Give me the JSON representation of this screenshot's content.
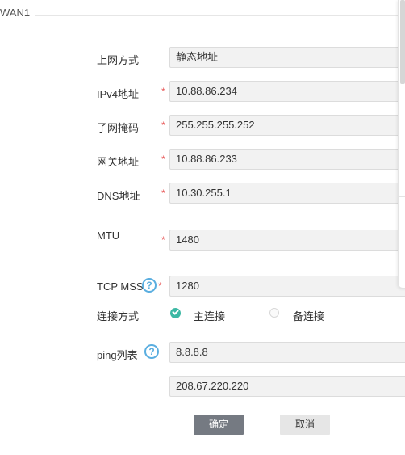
{
  "section": {
    "title": "WAN1"
  },
  "form": {
    "mode": {
      "label": "上网方式",
      "value": "静态地址"
    },
    "ipv4": {
      "label": "IPv4地址",
      "value": "10.88.86.234"
    },
    "mask": {
      "label": "子网掩码",
      "value": "255.255.255.252"
    },
    "gateway": {
      "label": "网关地址",
      "value": "10.88.86.233"
    },
    "dns": {
      "label": "DNS地址",
      "value": "10.30.255.1"
    },
    "mtu": {
      "label": "MTU",
      "value": "1480"
    },
    "tcp_mss": {
      "label": "TCP MSS",
      "value": "1280"
    },
    "connection": {
      "label": "连接方式",
      "options": [
        "主连接",
        "备连接"
      ],
      "selected": "主连接"
    },
    "ping_list": {
      "label": "ping列表",
      "values": [
        "8.8.8.8",
        "208.67.220.220"
      ]
    },
    "required_mark": "*",
    "help_glyph": "?"
  },
  "buttons": {
    "confirm": "确定",
    "cancel": "取消"
  },
  "colors": {
    "required": "#e85a5a",
    "help": "#5aaee0",
    "radio_selected": "#3cb8a4",
    "primary_button": "#757a82",
    "field_bg": "#f2f2f2"
  },
  "icons": {
    "help": "question-circle-icon",
    "radio_checked": "check-circle-icon"
  }
}
